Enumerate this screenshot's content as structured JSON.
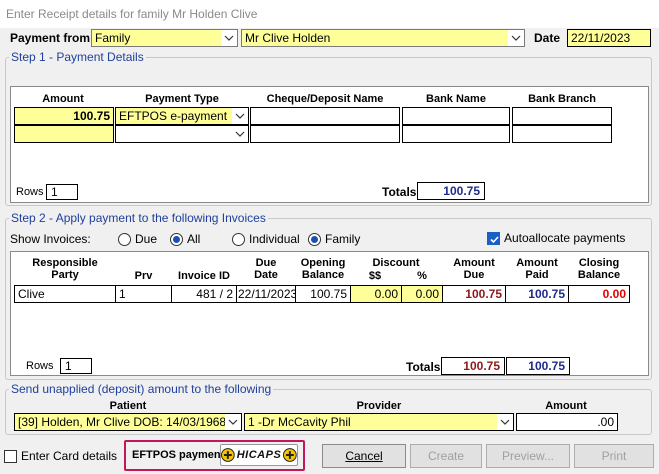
{
  "window": {
    "title": "Enter Receipt details for family Mr  Holden  Clive"
  },
  "payment_from": {
    "label": "Payment from",
    "type_value": "Family",
    "name_value": "Mr Clive  Holden"
  },
  "date": {
    "label": "Date",
    "value": "22/11/2023"
  },
  "step1": {
    "legend": "Step 1 - Payment Details",
    "headers": {
      "amount": "Amount",
      "payment_type": "Payment Type",
      "cheque": "Cheque/Deposit Name",
      "bank_name": "Bank Name",
      "bank_branch": "Bank Branch"
    },
    "row1": {
      "amount": "100.75",
      "payment_type": "EFTPOS e-payment"
    },
    "rows_label": "Rows",
    "rows_value": "1",
    "totals_label": "Totals",
    "totals_value": "100.75"
  },
  "step2": {
    "legend": "Step 2 - Apply payment to the following Invoices",
    "show_label": "Show Invoices:",
    "options": {
      "due": "Due",
      "all": "All",
      "individual": "Individual",
      "family": "Family"
    },
    "autoallocate": "Autoallocate payments",
    "headers": {
      "responsible_1": "Responsible",
      "responsible_2": "Party",
      "prv": "Prv",
      "invoice_id": "Invoice ID",
      "due_date_1": "Due",
      "due_date_2": "Date",
      "opening_1": "Opening",
      "opening_2": "Balance",
      "discount": "Discount",
      "disc_dollars": "$$",
      "disc_pct": "%",
      "amount_due_1": "Amount",
      "amount_due_2": "Due",
      "amount_paid_1": "Amount",
      "amount_paid_2": "Paid",
      "closing_1": "Closing",
      "closing_2": "Balance"
    },
    "row": {
      "party": "Clive",
      "prv": "1",
      "invoice": "481 / 2",
      "due_date": "22/11/2023",
      "opening": "100.75",
      "disc_dollars": "0.00",
      "disc_pct": "0.00",
      "amount_due": "100.75",
      "amount_paid": "100.75",
      "closing": "0.00"
    },
    "rows_label": "Rows",
    "rows_value": "1",
    "totals_label": "Totals",
    "totals_due": "100.75",
    "totals_paid": "100.75"
  },
  "unapplied": {
    "legend": "Send unapplied (deposit) amount to the following",
    "headers": {
      "patient": "Patient",
      "provider": "Provider",
      "amount": "Amount"
    },
    "patient_value": "[39] Holden, Mr Clive DOB: 14/03/1968",
    "provider_value": "1 -Dr McCavity Phil",
    "amount_value": ".00"
  },
  "footer": {
    "card_details": "Enter Card details",
    "eftpos_label": "EFTPOS payment",
    "hicaps_logo": "HICAPS",
    "cancel": "Cancel",
    "create": "Create",
    "preview": "Preview...",
    "print": "Print"
  },
  "colors": {
    "field_yellow": "#ffff99",
    "legend_blue": "#1f3f9c",
    "maroon": "#8b1a1a",
    "navy": "#1e2a8c",
    "red": "#e00000",
    "highlight_border": "#c2185b"
  }
}
